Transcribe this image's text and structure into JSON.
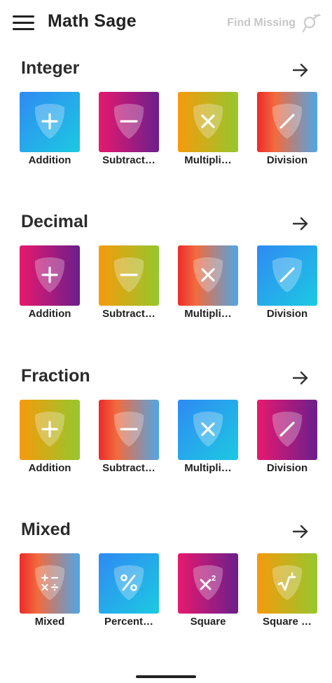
{
  "app": {
    "title": "Math Sage",
    "find_missing_label": "Find Missing"
  },
  "sections": [
    {
      "title": "Integer",
      "tiles": [
        {
          "label": "Addition",
          "icon": "plus-icon",
          "gradient": "blue"
        },
        {
          "label": "Subtract…",
          "icon": "minus-icon",
          "gradient": "pink"
        },
        {
          "label": "Multipli…",
          "icon": "multiply-icon",
          "gradient": "orange"
        },
        {
          "label": "Division",
          "icon": "divide-icon",
          "gradient": "red"
        }
      ]
    },
    {
      "title": "Decimal",
      "tiles": [
        {
          "label": "Addition",
          "icon": "plus-icon",
          "gradient": "pink"
        },
        {
          "label": "Subtract…",
          "icon": "minus-icon",
          "gradient": "orange"
        },
        {
          "label": "Multipli…",
          "icon": "multiply-icon",
          "gradient": "red"
        },
        {
          "label": "Division",
          "icon": "divide-icon",
          "gradient": "blue"
        }
      ]
    },
    {
      "title": "Fraction",
      "tiles": [
        {
          "label": "Addition",
          "icon": "plus-icon",
          "gradient": "orange"
        },
        {
          "label": "Subtract…",
          "icon": "minus-icon",
          "gradient": "red"
        },
        {
          "label": "Multipli…",
          "icon": "multiply-icon",
          "gradient": "blue"
        },
        {
          "label": "Division",
          "icon": "divide-icon",
          "gradient": "pink"
        }
      ]
    },
    {
      "title": "Mixed",
      "tiles": [
        {
          "label": "Mixed",
          "icon": "mixed-operators-icon",
          "gradient": "red"
        },
        {
          "label": "Percent…",
          "icon": "percent-icon",
          "gradient": "blue"
        },
        {
          "label": "Square",
          "icon": "square-icon",
          "gradient": "pink"
        },
        {
          "label": "Square …",
          "icon": "square-root-icon",
          "gradient": "orange"
        }
      ]
    }
  ],
  "colors": {
    "blue": [
      "#2f8af3",
      "#1cc9e2"
    ],
    "pink": [
      "#e6196e",
      "#6b1f8c"
    ],
    "orange": [
      "#f59a0c",
      "#96c72d"
    ],
    "red": [
      "#ee2a2a",
      "#4fa6e6"
    ],
    "find_missing": "#c7c7c7",
    "text": "#222222"
  }
}
